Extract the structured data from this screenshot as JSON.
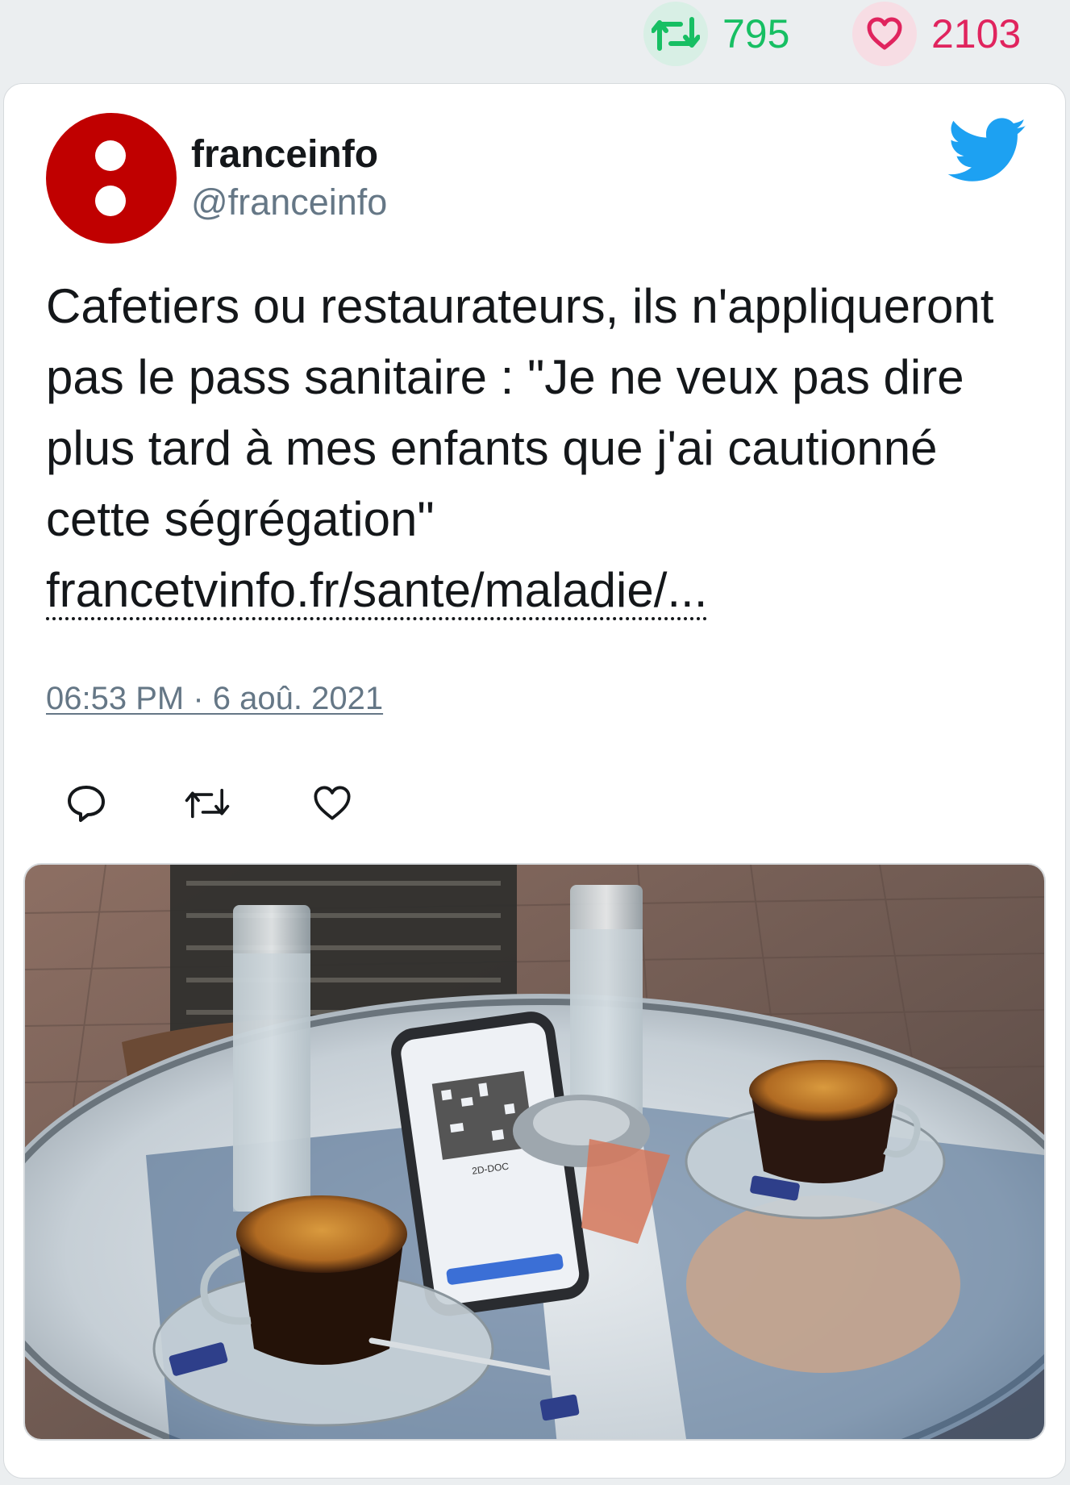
{
  "stats": {
    "retweets": "795",
    "likes": "2103"
  },
  "tweet": {
    "display_name": "franceinfo",
    "handle": "@franceinfo",
    "text": "Cafetiers ou restaurateurs, ils n'appliqueront pas le pass sanitaire : \"Je ne veux pas dire plus tard à mes enfants que j'ai cautionné cette ségrégation\" ",
    "link_text": "francetvinfo.fr/sante/maladie/...",
    "timestamp": "06:53 PM · 6 aoû. 2021"
  },
  "icons": {
    "retweet_stat": "retweet-icon",
    "like_stat": "heart-icon",
    "brand": "twitter-bird-icon",
    "reply_action": "reply-icon",
    "retweet_action": "retweet-icon",
    "like_action": "heart-icon"
  },
  "colors": {
    "retweet_green": "#17bf63",
    "like_pink": "#e0245e",
    "twitter_blue": "#1da1f2",
    "avatar_red": "#c00000",
    "muted_text": "#657786"
  },
  "media": {
    "phone_code_label": "2D-DOC"
  }
}
